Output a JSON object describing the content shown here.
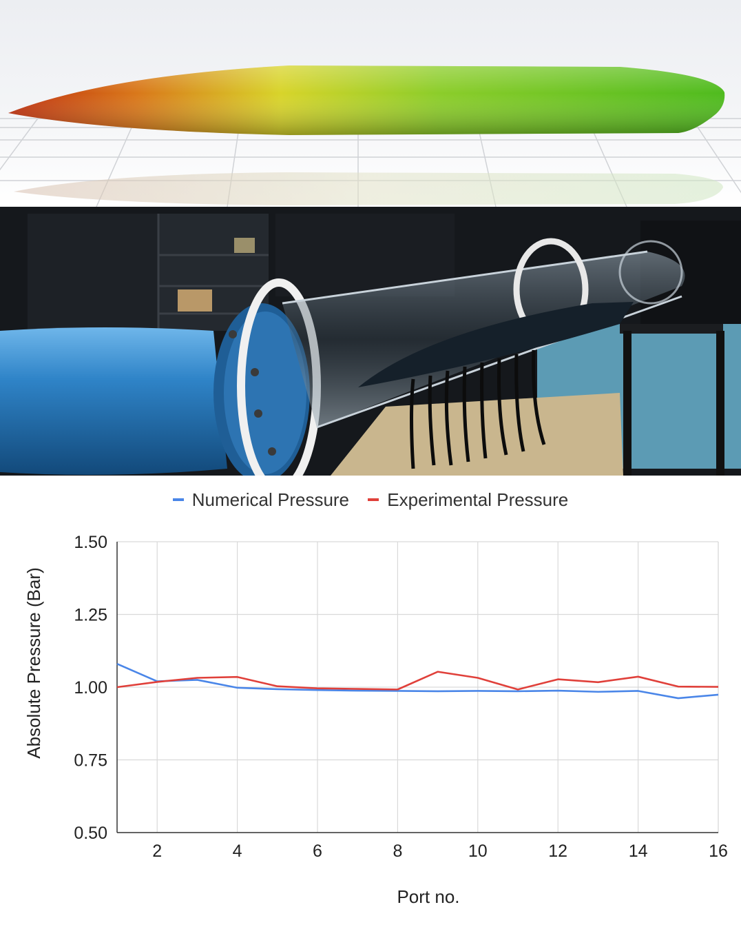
{
  "chart_data": {
    "type": "line",
    "title": "",
    "xlabel": "Port no.",
    "ylabel": "Absolute Pressure (Bar)",
    "x": [
      1,
      2,
      3,
      4,
      5,
      6,
      7,
      8,
      9,
      10,
      11,
      12,
      13,
      14,
      15,
      16
    ],
    "xticks": [
      2,
      4,
      6,
      8,
      10,
      12,
      14,
      16
    ],
    "xlim": [
      1,
      16
    ],
    "yticks": [
      "0.50",
      "0.75",
      "1.00",
      "1.25",
      "1.50"
    ],
    "ylim": [
      0.5,
      1.5
    ],
    "grid": true,
    "legend_position": "top",
    "series": [
      {
        "name": "Numerical Pressure",
        "color": "#4a86e8",
        "values": [
          1.08,
          1.02,
          1.025,
          0.998,
          0.993,
          0.99,
          0.988,
          0.987,
          0.986,
          0.987,
          0.986,
          0.988,
          0.984,
          0.987,
          0.962,
          0.974
        ]
      },
      {
        "name": "Experimental Pressure",
        "color": "#e0403a",
        "values": [
          1.0,
          1.018,
          1.032,
          1.035,
          1.003,
          0.996,
          0.994,
          0.992,
          1.053,
          1.032,
          0.992,
          1.027,
          1.017,
          1.036,
          1.002,
          1.001
        ]
      }
    ]
  }
}
